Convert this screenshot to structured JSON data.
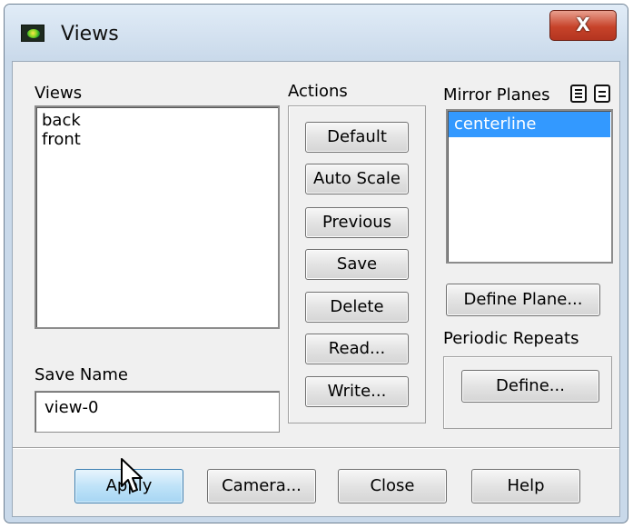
{
  "window": {
    "title": "Views",
    "close_label": "X"
  },
  "views_panel": {
    "label": "Views",
    "items": [
      "back",
      "front"
    ]
  },
  "save_name": {
    "label": "Save Name",
    "value": "view-0"
  },
  "actions": {
    "label": "Actions",
    "buttons": [
      "Default",
      "Auto Scale",
      "Previous",
      "Save",
      "Delete",
      "Read...",
      "Write..."
    ]
  },
  "mirror_planes": {
    "label": "Mirror Planes",
    "items": [
      "centerline"
    ],
    "selected_index": 0
  },
  "define_plane_label": "Define Plane...",
  "periodic_repeats": {
    "label": "Periodic Repeats",
    "define_label": "Define..."
  },
  "footer": {
    "apply": "Apply",
    "camera": "Camera...",
    "close": "Close",
    "help": "Help"
  },
  "colors": {
    "selection": "#3399ff",
    "close_button": "#c7432a",
    "window_frame": "#c9d9ea",
    "primary_button": "#bfe3f8"
  },
  "icons": [
    "app-logo-icon",
    "select-all-icon",
    "deselect-all-icon",
    "mouse-pointer-icon"
  ]
}
